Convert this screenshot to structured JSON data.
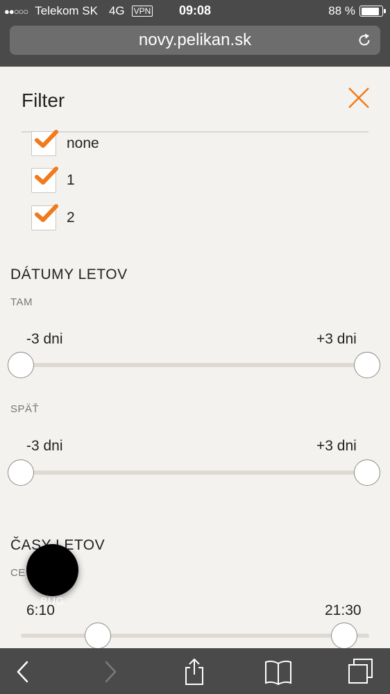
{
  "status_bar": {
    "signal": "●●○○○",
    "carrier": "Telekom SK",
    "network": "4G",
    "vpn": "VPN",
    "time": "09:08",
    "battery": "88 %",
    "battery_level": 0.88
  },
  "browser": {
    "url": "novy.pelikan.sk"
  },
  "filter": {
    "title": "Filter",
    "accent_color": "#f07a1c",
    "stops": [
      {
        "label": "none",
        "checked": true
      },
      {
        "label": "1",
        "checked": true
      },
      {
        "label": "2",
        "checked": true
      }
    ]
  },
  "flight_dates": {
    "title": "DÁTUMY LETOV",
    "outbound": {
      "label": "TAM",
      "min_label": "-3 dni",
      "max_label": "+3 dni",
      "min_value": -3,
      "max_value": 3
    },
    "return": {
      "label": "SPÄŤ",
      "min_label": "-3 dni",
      "max_label": "+3 dni",
      "min_value": -3,
      "max_value": 3
    }
  },
  "flight_times": {
    "title": "ČASY LETOV",
    "sub_label": "CE",
    "min_label": "6:10",
    "max_label": "21:30"
  },
  "bug_button": {
    "label": "BUG"
  }
}
